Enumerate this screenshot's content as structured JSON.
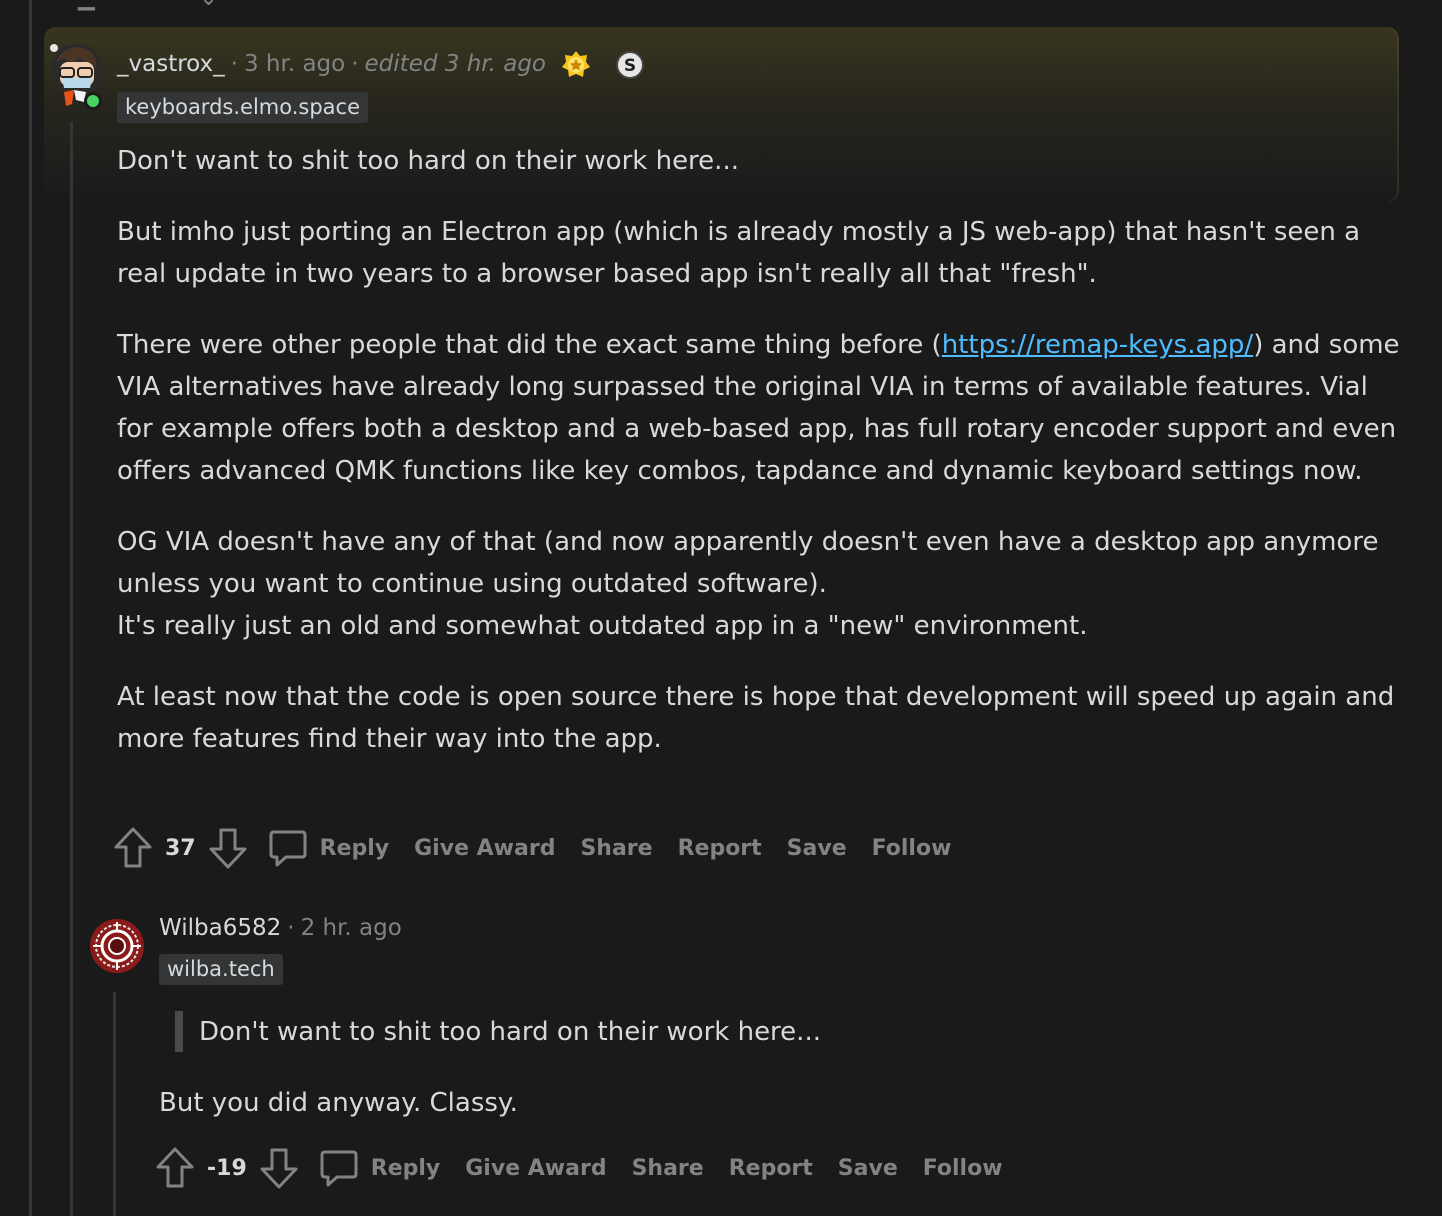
{
  "comment1": {
    "author": "_vastrox_",
    "time": "3 hr. ago",
    "edited": "edited 3 hr. ago",
    "flair": "keyboards.elmo.space",
    "paragraphs": {
      "p1": "Don't want to shit too hard on their work here...",
      "p2": "But imho just porting an Electron app (which is already mostly a JS web-app) that hasn't seen a real update in two years to a browser based app isn't really all that \"fresh\".",
      "p3_before": "There were other people that did the exact same thing before (",
      "p3_link": "https://remap-keys.app/",
      "p3_after": ") and some VIA alternatives have already long surpassed the original VIA in terms of available features. Vial for example offers both a desktop and a web-based app, has full rotary encoder support and even offers advanced QMK functions like key combos, tapdance and dynamic keyboard settings now.",
      "p4_line1": "OG VIA doesn't have any of that (and now apparently doesn't even have a desktop app anymore unless you want to continue using outdated software).",
      "p4_line2": "It's really just an old and somewhat outdated app in a \"new\" environment.",
      "p5": "At least now that the code is open source there is hope that development will speed up again and more features find their way into the app."
    },
    "score": "37"
  },
  "comment2": {
    "author": "Wilba6582",
    "time": "2 hr. ago",
    "flair": "wilba.tech",
    "quote": "Don't want to shit too hard on their work here...",
    "body": "But you did anyway. Classy.",
    "score": "-19"
  },
  "actions": {
    "reply": "Reply",
    "give_award": "Give Award",
    "share": "Share",
    "report": "Report",
    "save": "Save",
    "follow": "Follow"
  },
  "icons": {
    "upvote": "arrow-up-icon",
    "downvote": "arrow-down-icon",
    "comment": "speech-bubble-icon",
    "award_gold": "star-award-icon",
    "award_s": "s-badge-icon"
  },
  "colors": {
    "background": "#1a1a1b",
    "text": "#d7dadc",
    "muted": "#818384",
    "link": "#4fbcff",
    "online": "#46d160"
  }
}
